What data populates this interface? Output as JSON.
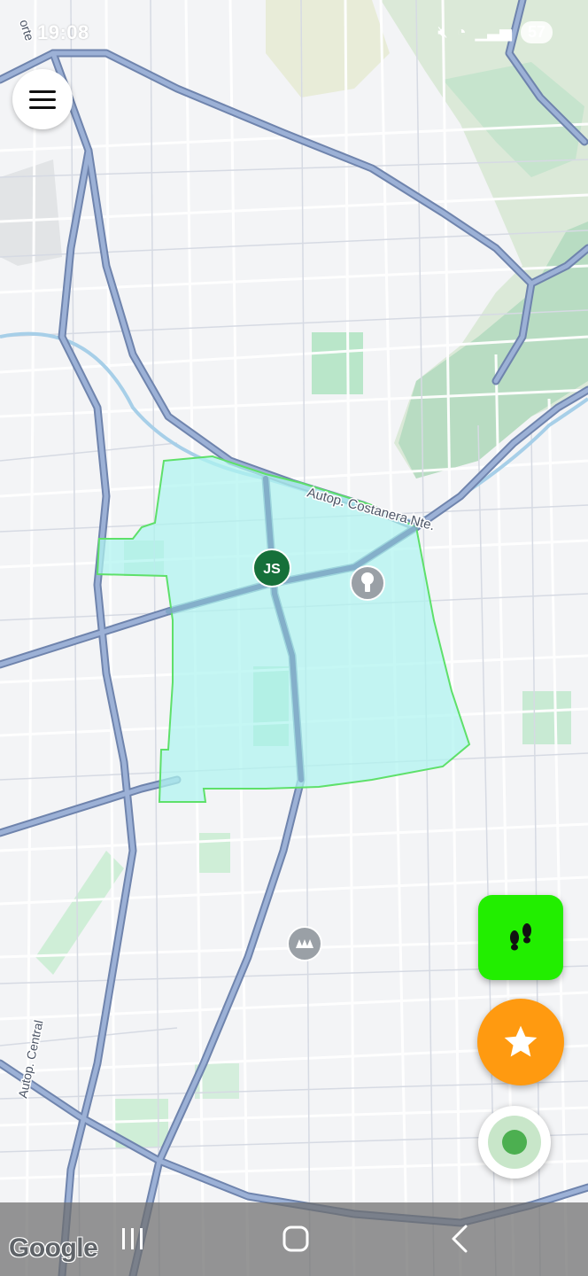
{
  "status_bar": {
    "time": "19:08",
    "battery": "57"
  },
  "map": {
    "road_labels": [
      "Autop. Costanera Nte.",
      "Autop. Central",
      "orte"
    ],
    "user_marker": "JS",
    "attribution": "Google",
    "colors": {
      "zone_fill": "#aef4f0",
      "zone_border": "#5ee06a",
      "highway": "#8aa0c8",
      "park": "#b9e6c9",
      "user_marker": "#16703a"
    },
    "pois": [
      "lightbulb-poi",
      "metro-poi"
    ]
  },
  "buttons": {
    "menu": "menu-icon",
    "walk": "footprints-icon",
    "favorite": "star-icon",
    "location": "location-icon"
  },
  "colors": {
    "walk_fab": "#22ee00",
    "star_fab": "#ff9a10",
    "location_dot": "#4caf50"
  }
}
